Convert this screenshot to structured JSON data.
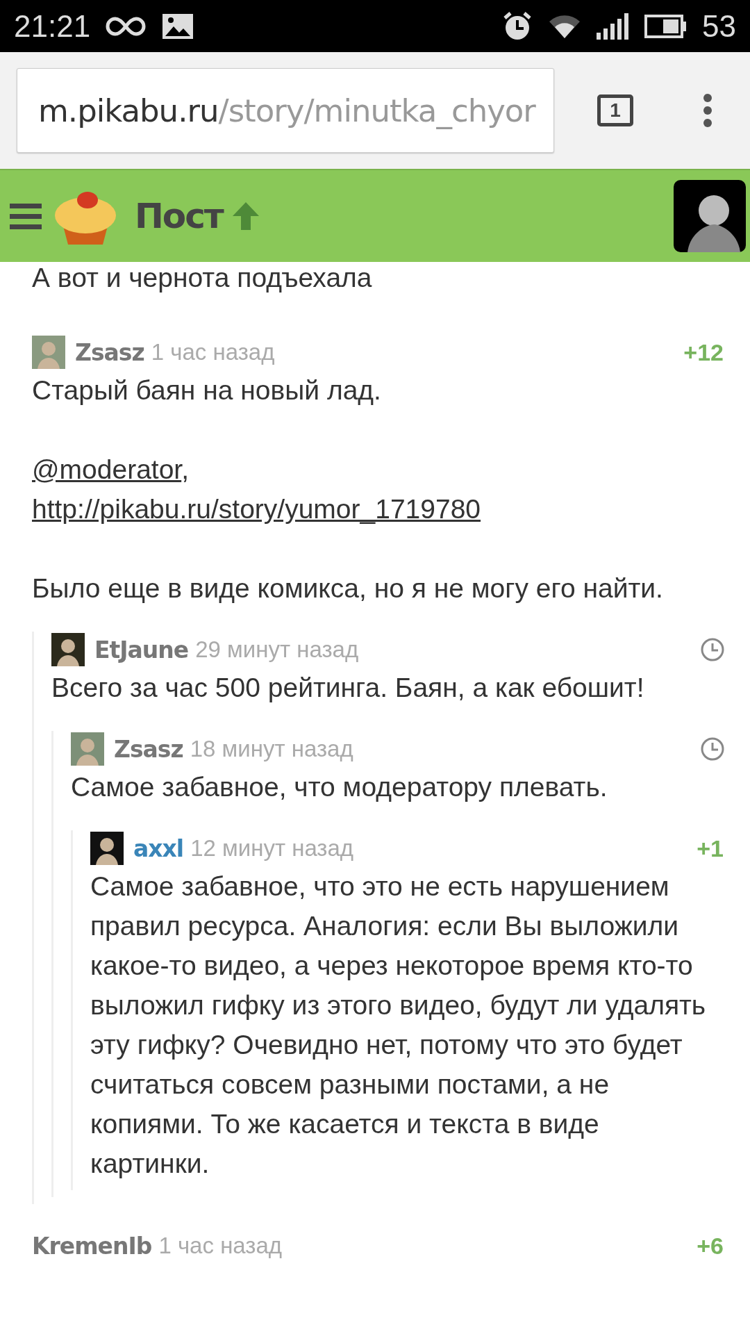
{
  "status_bar": {
    "time": "21:21",
    "battery": "53"
  },
  "browser": {
    "url_host": "m.pikabu.ru",
    "url_path": "/story/minutka_chyor",
    "tab_count": "1"
  },
  "header": {
    "title": "Пост"
  },
  "post_tail": "А вот и чернота подъехала",
  "comments": [
    {
      "author": "Zsasz",
      "time": "1 час назад",
      "kind": "rating",
      "rating": "+12",
      "color": "#8a9a80",
      "author_highlight": false,
      "blocks": [
        [
          [
            {
              "text": "Старый баян на новый лад.",
              "link": false
            }
          ]
        ],
        [
          [
            {
              "text": "@moderator",
              "link": true
            },
            {
              "text": ",",
              "link": false
            }
          ],
          [
            {
              "text": "http://pikabu.ru/story/yumor_1719780",
              "link": true
            }
          ]
        ],
        [
          [
            {
              "text": "Было еще в виде комикса, но я не могу его найти.",
              "link": false
            }
          ]
        ]
      ],
      "children": [
        {
          "author": "EtJaune",
          "time": "29 минут назад",
          "kind": "pending",
          "color": "#2b2a1c",
          "author_highlight": false,
          "blocks": [
            [
              [
                {
                  "text": "Всего за час 500 рейтинга. Баян, а как ебошит!",
                  "link": false
                }
              ]
            ]
          ],
          "children": [
            {
              "author": "Zsasz",
              "time": "18 минут назад",
              "kind": "pending",
              "color": "#7d9078",
              "author_highlight": false,
              "blocks": [
                [
                  [
                    {
                      "text": "Самое забавное, что модератору плевать.",
                      "link": false
                    }
                  ]
                ]
              ],
              "children": [
                {
                  "author": "axxl",
                  "time": "12 минут назад",
                  "kind": "rating",
                  "rating": "+1",
                  "color": "#111111",
                  "author_highlight": true,
                  "blocks": [
                    [
                      [
                        {
                          "text": "Самое забавное, что это не есть нарушением правил ресурса. Аналогия: если Вы выложили какое-то видео, а через некоторое время кто-то выложил гифку из этого видео, будут ли удалять эту гифку? Очевидно нет, потому что это будет считаться совсем разными постами, а не копиями. То же касается и текста в виде картинки.",
                          "link": false
                        }
                      ]
                    ]
                  ]
                }
              ]
            }
          ]
        }
      ]
    },
    {
      "author": "KremenIb",
      "time": "1 час назад",
      "kind": "rating",
      "rating": "+6",
      "author_highlight": false
    }
  ]
}
